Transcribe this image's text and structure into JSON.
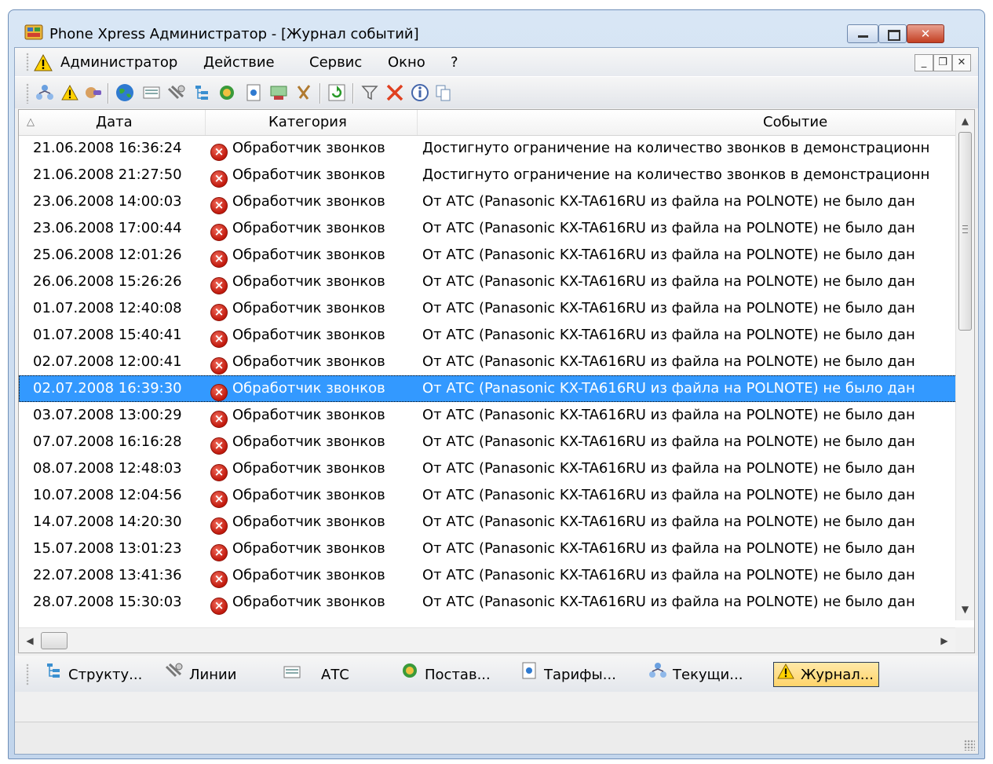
{
  "window": {
    "title": "Phone Xpress Администратор - [Журнал событий]"
  },
  "menu": {
    "items": [
      "Администратор",
      "Действие",
      "Сервис",
      "Окно",
      "?"
    ]
  },
  "toolbar": {
    "icons": [
      "structure-icon",
      "warning-icon",
      "hand-icon",
      "globe-icon",
      "pbx-icon",
      "lines-icon",
      "tree-icon",
      "provider-icon",
      "tariff-icon",
      "money-icon",
      "tools-icon",
      "refresh-icon",
      "filter-icon",
      "delete-icon",
      "info-icon",
      "copy-icon"
    ]
  },
  "table": {
    "columns": [
      "Дата",
      "Категория",
      "Событие"
    ],
    "selected_index": 9,
    "rows": [
      {
        "date": "21.06.2008 16:36:24",
        "category": "Обработчик звонков",
        "event": "Достигнуто ограничение на количество звонков в демонстрационн"
      },
      {
        "date": "21.06.2008 21:27:50",
        "category": "Обработчик звонков",
        "event": "Достигнуто ограничение на количество звонков в демонстрационн"
      },
      {
        "date": "23.06.2008 14:00:03",
        "category": "Обработчик звонков",
        "event": "От АТС (Panasonic KX-TA616RU из файла на POLNOTE) не было дан"
      },
      {
        "date": "23.06.2008 17:00:44",
        "category": "Обработчик звонков",
        "event": "От АТС (Panasonic KX-TA616RU из файла на POLNOTE) не было дан"
      },
      {
        "date": "25.06.2008 12:01:26",
        "category": "Обработчик звонков",
        "event": "От АТС (Panasonic KX-TA616RU из файла на POLNOTE) не было дан"
      },
      {
        "date": "26.06.2008 15:26:26",
        "category": "Обработчик звонков",
        "event": "От АТС (Panasonic KX-TA616RU из файла на POLNOTE) не было дан"
      },
      {
        "date": "01.07.2008 12:40:08",
        "category": "Обработчик звонков",
        "event": "От АТС (Panasonic KX-TA616RU из файла на POLNOTE) не было дан"
      },
      {
        "date": "01.07.2008 15:40:41",
        "category": "Обработчик звонков",
        "event": "От АТС (Panasonic KX-TA616RU из файла на POLNOTE) не было дан"
      },
      {
        "date": "02.07.2008 12:00:41",
        "category": "Обработчик звонков",
        "event": "От АТС (Panasonic KX-TA616RU из файла на POLNOTE) не было дан"
      },
      {
        "date": "02.07.2008 16:39:30",
        "category": "Обработчик звонков",
        "event": "От АТС (Panasonic KX-TA616RU из файла на POLNOTE) не было дан"
      },
      {
        "date": "03.07.2008 13:00:29",
        "category": "Обработчик звонков",
        "event": "От АТС (Panasonic KX-TA616RU из файла на POLNOTE) не было дан"
      },
      {
        "date": "07.07.2008 16:16:28",
        "category": "Обработчик звонков",
        "event": "От АТС (Panasonic KX-TA616RU из файла на POLNOTE) не было дан"
      },
      {
        "date": "08.07.2008 12:48:03",
        "category": "Обработчик звонков",
        "event": "От АТС (Panasonic KX-TA616RU из файла на POLNOTE) не было дан"
      },
      {
        "date": "10.07.2008 12:04:56",
        "category": "Обработчик звонков",
        "event": "От АТС (Panasonic KX-TA616RU из файла на POLNOTE) не было дан"
      },
      {
        "date": "14.07.2008 14:20:30",
        "category": "Обработчик звонков",
        "event": "От АТС (Panasonic KX-TA616RU из файла на POLNOTE) не было дан"
      },
      {
        "date": "15.07.2008 13:01:23",
        "category": "Обработчик звонков",
        "event": "От АТС (Panasonic KX-TA616RU из файла на POLNOTE) не было дан"
      },
      {
        "date": "22.07.2008 13:41:36",
        "category": "Обработчик звонков",
        "event": "От АТС (Panasonic KX-TA616RU из файла на POLNOTE) не было дан"
      },
      {
        "date": "28.07.2008 15:30:03",
        "category": "Обработчик звонков",
        "event": "От АТС (Panasonic KX-TA616RU из файла на POLNOTE) не было дан"
      }
    ]
  },
  "tabs": [
    {
      "icon": "structure-tree-icon",
      "label": "Структу..."
    },
    {
      "icon": "lines-icon",
      "label": "Линии"
    },
    {
      "icon": "pbx-icon",
      "label": "АТС"
    },
    {
      "icon": "provider-icon",
      "label": "Постав..."
    },
    {
      "icon": "tariff-icon",
      "label": "Тарифы..."
    },
    {
      "icon": "current-calls-icon",
      "label": "Текущи..."
    },
    {
      "icon": "warning-icon",
      "label": "Журнал...",
      "active": true
    }
  ],
  "colors": {
    "selection": "#3399ff",
    "error_icon": "#d0200f",
    "active_tab": "#ffd46b"
  }
}
